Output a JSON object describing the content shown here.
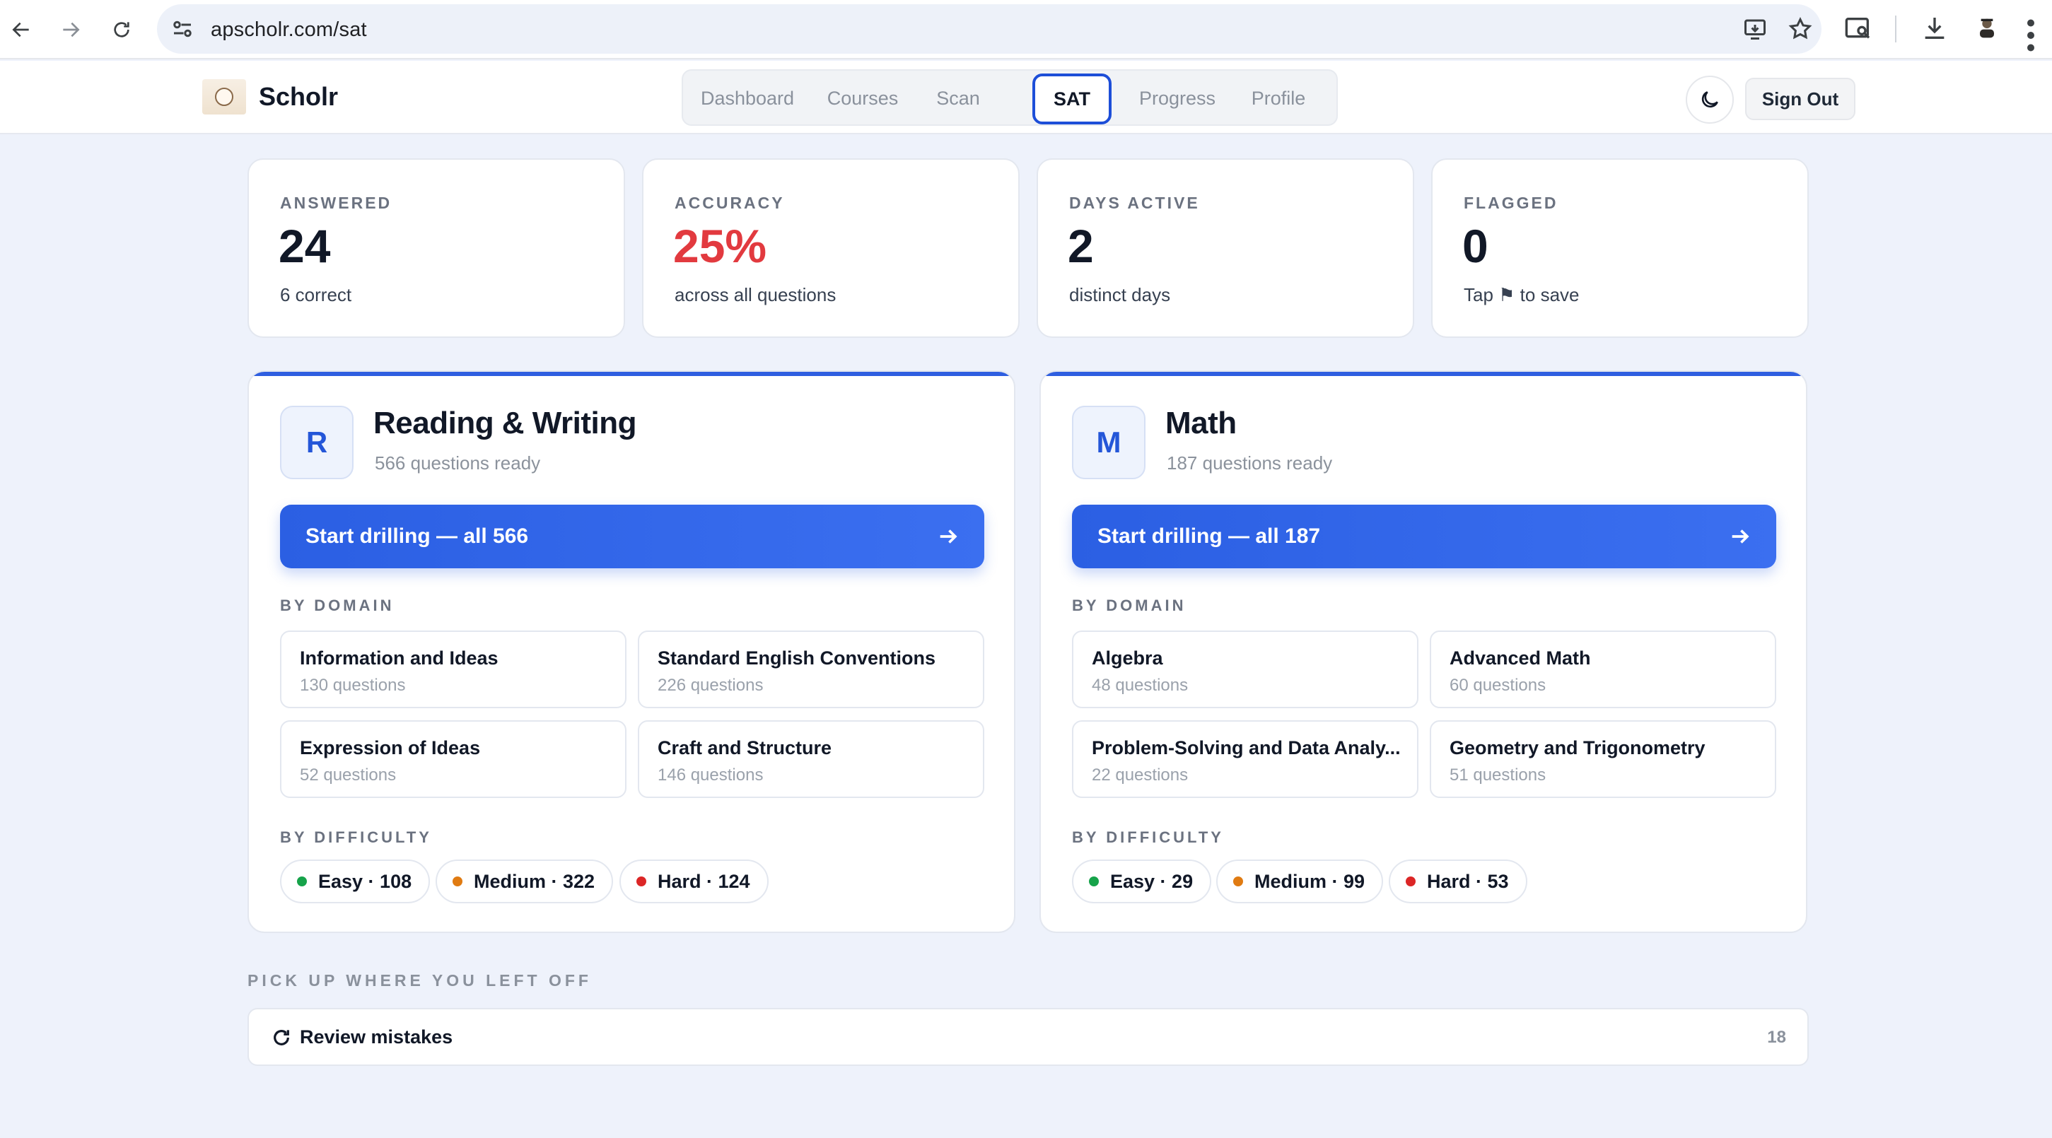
{
  "browser": {
    "url": "apscholr.com/sat"
  },
  "header": {
    "brand": "Scholr",
    "tabs": [
      {
        "label": "Dashboard",
        "active": false
      },
      {
        "label": "Courses",
        "active": false
      },
      {
        "label": "Scan",
        "active": false
      },
      {
        "label": "SAT",
        "active": true
      },
      {
        "label": "Progress",
        "active": false
      },
      {
        "label": "Profile",
        "active": false
      }
    ],
    "sign_out_label": "Sign Out"
  },
  "stats": [
    {
      "label": "ANSWERED",
      "value": "24",
      "sub": "6 correct"
    },
    {
      "label": "ACCURACY",
      "value": "25%",
      "sub": "across all questions",
      "value_color": "#e23a3f"
    },
    {
      "label": "DAYS ACTIVE",
      "value": "2",
      "sub": "distinct days"
    },
    {
      "label": "FLAGGED",
      "value": "0",
      "sub": "Tap ⚑ to save"
    }
  ],
  "subjects": [
    {
      "badge": "R",
      "title": "Reading & Writing",
      "subtitle": "566 questions ready",
      "drill_label": "Start drilling — all 566",
      "domain_heading": "BY DOMAIN",
      "domains": [
        {
          "name": "Information and Ideas",
          "count": "130 questions"
        },
        {
          "name": "Standard English Conventions",
          "count": "226 questions"
        },
        {
          "name": "Expression of Ideas",
          "count": "52 questions"
        },
        {
          "name": "Craft and Structure",
          "count": "146 questions"
        }
      ],
      "difficulty_heading": "BY DIFFICULTY",
      "difficulties": [
        {
          "label": "Easy · 108",
          "color": "#16a34a"
        },
        {
          "label": "Medium · 322",
          "color": "#e07b12"
        },
        {
          "label": "Hard · 124",
          "color": "#dc2626"
        }
      ]
    },
    {
      "badge": "M",
      "title": "Math",
      "subtitle": "187 questions ready",
      "drill_label": "Start drilling — all 187",
      "domain_heading": "BY DOMAIN",
      "domains": [
        {
          "name": "Algebra",
          "count": "48 questions"
        },
        {
          "name": "Advanced Math",
          "count": "60 questions"
        },
        {
          "name": "Problem-Solving and Data Analy...",
          "count": "22 questions"
        },
        {
          "name": "Geometry and Trigonometry",
          "count": "51 questions"
        }
      ],
      "difficulty_heading": "BY DIFFICULTY",
      "difficulties": [
        {
          "label": "Easy · 29",
          "color": "#16a34a"
        },
        {
          "label": "Medium · 99",
          "color": "#e07b12"
        },
        {
          "label": "Hard · 53",
          "color": "#dc2626"
        }
      ]
    }
  ],
  "resume": {
    "heading": "PICK UP WHERE YOU LEFT OFF",
    "item_label": "Review mistakes",
    "item_count": "18"
  },
  "colors": {
    "accent": "#2f5fe0",
    "accuracy_red": "#e23a3f"
  }
}
